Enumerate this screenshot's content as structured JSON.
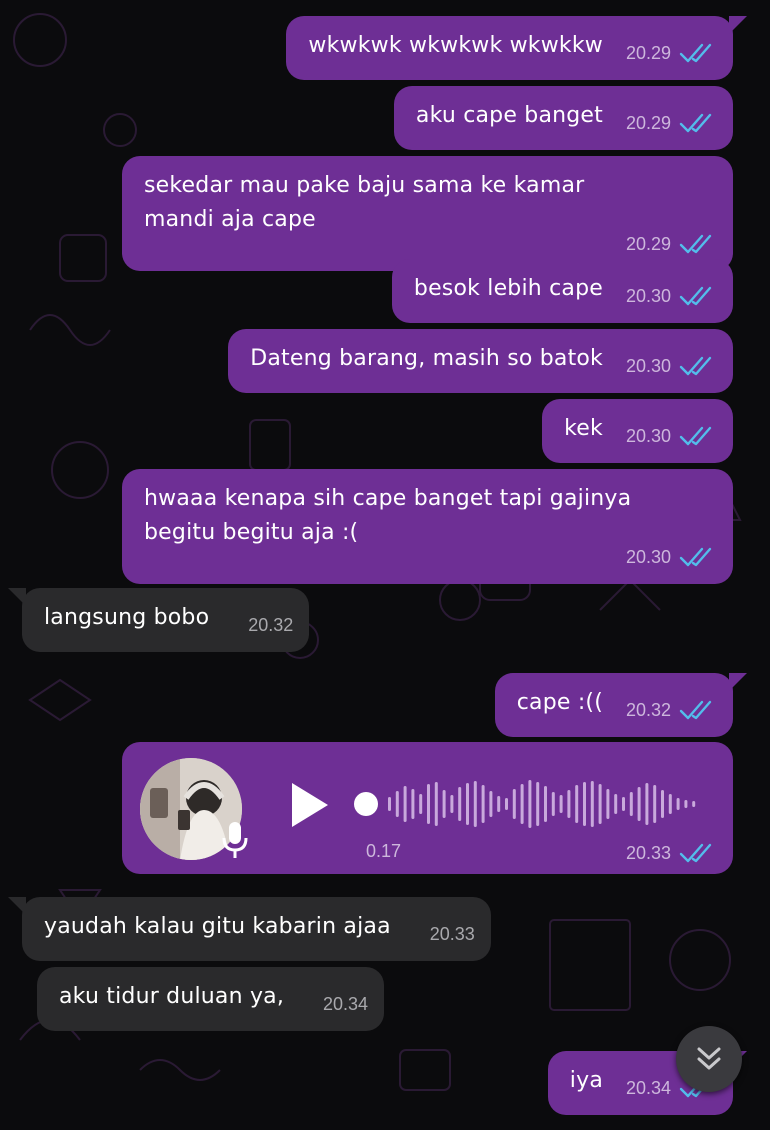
{
  "colors": {
    "outgoing_bubble": "#6e2f95",
    "incoming_bubble": "#2a2a2c",
    "background": "#0b0b0d",
    "read_ticks": "#53bdeb"
  },
  "messages": [
    {
      "dir": "out",
      "text": "wkwkwk wkwkwk wkwkkw",
      "time": "20.29",
      "status": "read"
    },
    {
      "dir": "out",
      "text": "aku cape banget",
      "time": "20.29",
      "status": "read"
    },
    {
      "dir": "out",
      "text": "sekedar mau pake baju sama ke kamar\nmandi aja cape",
      "time": "20.29",
      "status": "read"
    },
    {
      "dir": "out",
      "text": "besok lebih cape",
      "time": "20.30",
      "status": "read"
    },
    {
      "dir": "out",
      "text": "Dateng barang, masih so batok",
      "time": "20.30",
      "status": "read"
    },
    {
      "dir": "out",
      "text": "kek",
      "time": "20.30",
      "status": "read"
    },
    {
      "dir": "out",
      "text": "hwaaa kenapa sih cape banget tapi gajinya\nbegitu begitu aja :(",
      "time": "20.30",
      "status": "read"
    },
    {
      "dir": "in",
      "text": "langsung bobo",
      "time": "20.32"
    },
    {
      "dir": "out",
      "text": "cape :((",
      "time": "20.32",
      "status": "read"
    },
    {
      "dir": "in",
      "text": "yaudah kalau gitu kabarin ajaa",
      "time": "20.33"
    },
    {
      "dir": "in",
      "text": "aku tidur duluan ya,",
      "time": "20.34"
    },
    {
      "dir": "out",
      "text": "iya",
      "time": "20.34",
      "status": "read"
    }
  ],
  "voice_note": {
    "duration": "0.17",
    "time": "20.33",
    "status": "read",
    "progress": 0
  },
  "icons": {
    "play": "play-icon",
    "mic": "microphone-icon",
    "ticks": "double-check-icon",
    "scroll": "double-chevron-down-icon"
  }
}
